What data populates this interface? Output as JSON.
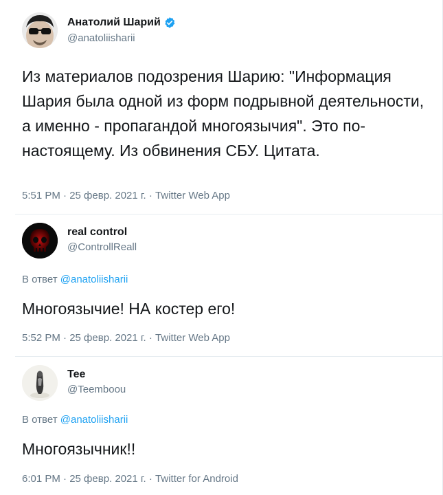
{
  "tweets": [
    {
      "name": "Анатолий Шарий",
      "handle": "@anatoliisharii",
      "verified": true,
      "avatar_icon": "sunglasses-man-avatar",
      "text": "Из материалов подозрения Шарию: \"Информация Шария была одной из форм подрывной деятельности, а именно - пропагандой многоязычия\". Это по-настоящему. Из обвинения СБУ. Цитата.",
      "meta": "5:51 PM · 25 февр. 2021 г. · Twitter Web App"
    },
    {
      "name": "real control",
      "handle": "@ControllReall",
      "avatar_icon": "red-skull-avatar",
      "reply_prefix": "В ответ",
      "reply_to": "@anatoliisharii",
      "text": "Многоязычие! НА костер его!",
      "meta": "5:52 PM · 25 февр. 2021 г. · Twitter Web App"
    },
    {
      "name": "Tee",
      "handle": "@Teemboou",
      "avatar_icon": "figurine-avatar",
      "reply_prefix": "В ответ",
      "reply_to": "@anatoliisharii",
      "text": "Многоязычник!!",
      "meta": "6:01 PM · 25 февр. 2021 г. · Twitter for Android"
    }
  ],
  "colors": {
    "text": "#14171a",
    "secondary": "#657786",
    "link": "#1da1f2",
    "divider": "#e6ecf0",
    "verified": "#1da1f2"
  }
}
